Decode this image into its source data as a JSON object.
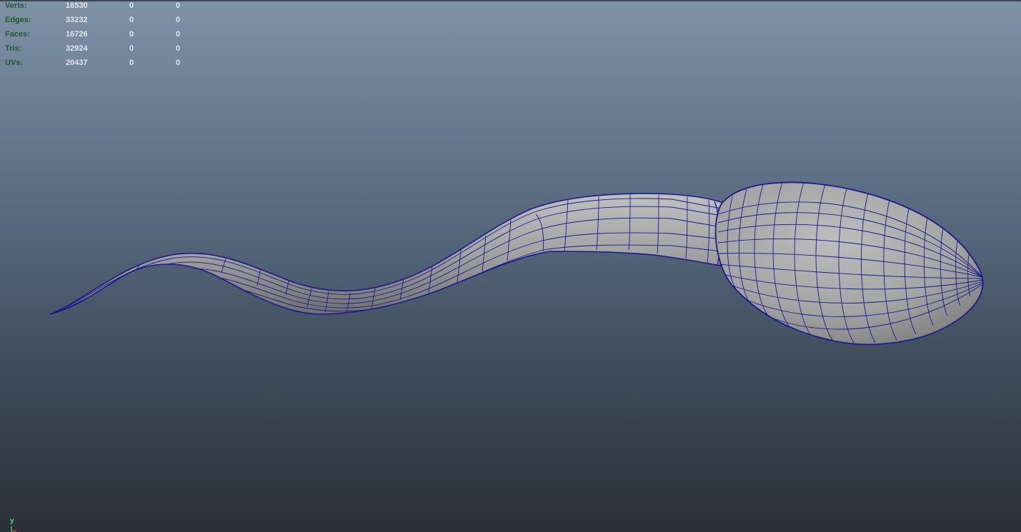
{
  "hud": {
    "rows": [
      {
        "label": "Verts:",
        "values": [
          "16530",
          "0",
          "0"
        ]
      },
      {
        "label": "Edges:",
        "values": [
          "33232",
          "0",
          "0"
        ]
      },
      {
        "label": "Faces:",
        "values": [
          "16726",
          "0",
          "0"
        ]
      },
      {
        "label": "Tris:",
        "values": [
          "32924",
          "0",
          "0"
        ]
      },
      {
        "label": "UVs:",
        "values": [
          "20437",
          "0",
          "0"
        ]
      }
    ]
  },
  "axis": {
    "label": "y"
  },
  "colors": {
    "wireframe": "#1a1a8c",
    "surface": "#a7a7a7",
    "hud_label": "#1c5a35",
    "axis_label": "#4de07a"
  }
}
